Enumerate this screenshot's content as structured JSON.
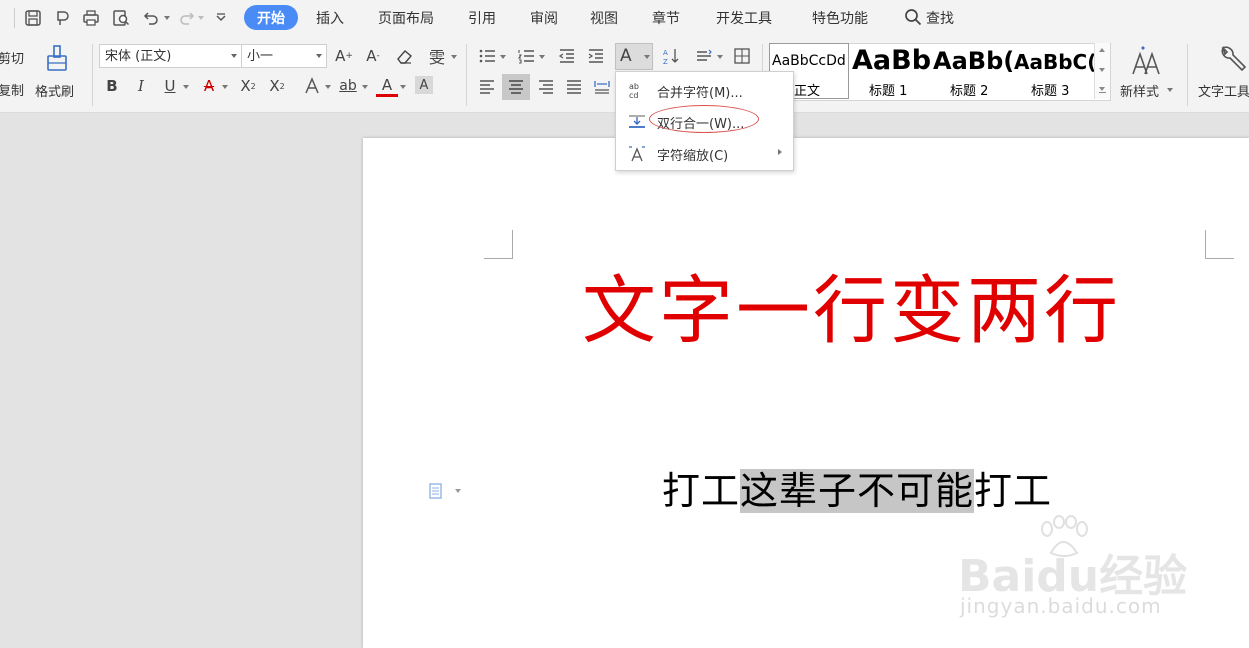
{
  "menu": {
    "tabs": [
      "开始",
      "插入",
      "页面布局",
      "引用",
      "审阅",
      "视图",
      "章节",
      "开发工具",
      "特色功能"
    ],
    "search": "查找"
  },
  "clipboard": {
    "cut": "剪切",
    "copy": "复制",
    "format_painter": "格式刷"
  },
  "font": {
    "family": "宋体 (正文)",
    "size": "小一"
  },
  "styles": {
    "items": [
      {
        "preview": "AaBbCcDd",
        "label": "正文"
      },
      {
        "preview": "AaBb",
        "label": "标题 1"
      },
      {
        "preview": "AaBb(",
        "label": "标题 2"
      },
      {
        "preview": "AaBbC(",
        "label": "标题 3"
      }
    ],
    "new_style": "新样式",
    "text_tools": "文字工具"
  },
  "dropdown": {
    "items": [
      {
        "label": "合并字符(M)..."
      },
      {
        "label": "双行合一(W)..."
      },
      {
        "label": "字符缩放(C)"
      }
    ]
  },
  "document": {
    "title": "文字一行变两行",
    "line_before": "打工",
    "line_selected": "这辈子不可能",
    "line_after": "打工"
  },
  "watermark": {
    "brand": "Baidu经验",
    "url": "jingyan.baidu.com"
  },
  "colors": {
    "accent": "#4a8bf5",
    "title_red": "#e00000",
    "selection": "#c6c6c6",
    "highlight_circle": "#d9534f"
  }
}
